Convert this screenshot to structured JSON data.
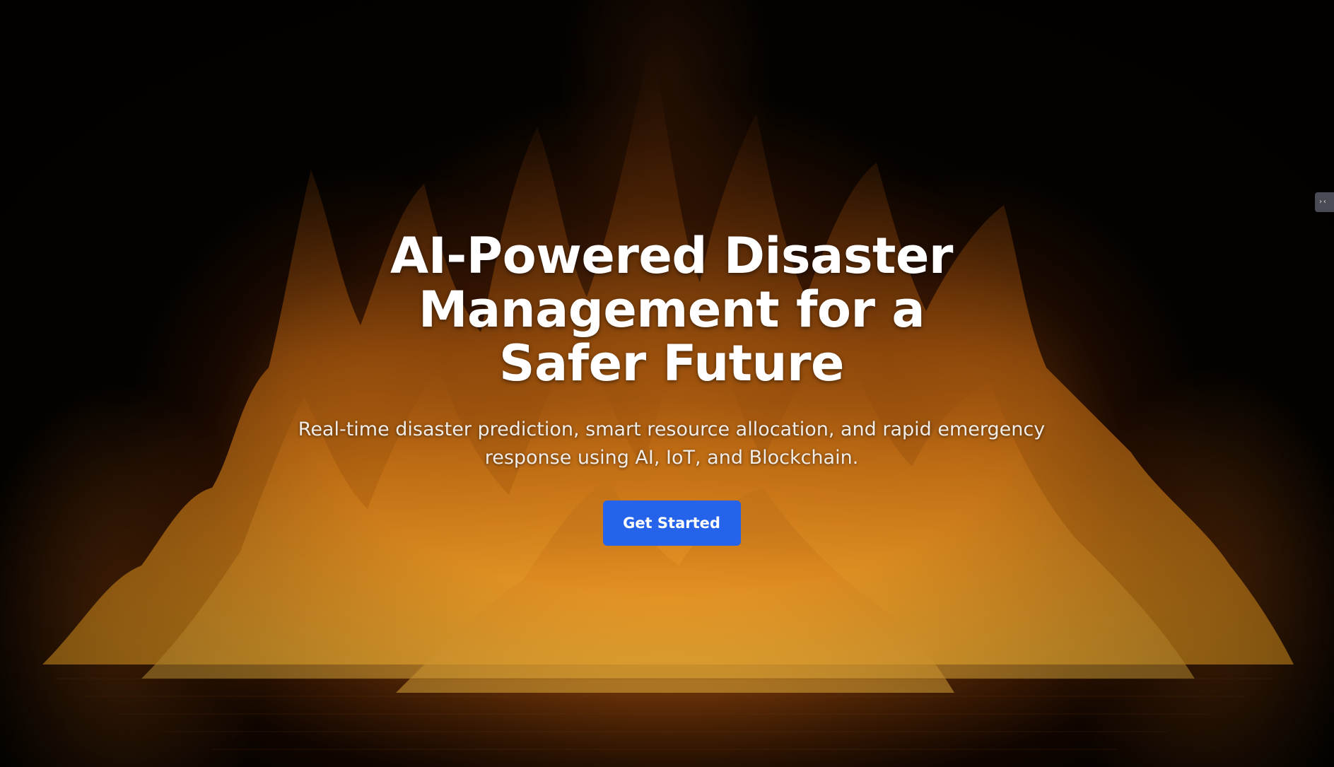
{
  "hero": {
    "title": "AI-Powered Disaster Management for a Safer Future",
    "subtitle": "Real-time disaster prediction, smart resource allocation, and rapid emergency response using AI, IoT, and Blockchain.",
    "cta_label": "Get Started",
    "cta_color": "#2563eb",
    "background": "fire-flames-image"
  },
  "side_tab": {
    "icon": "collapse-arrows-icon",
    "glyph": "›‹"
  }
}
